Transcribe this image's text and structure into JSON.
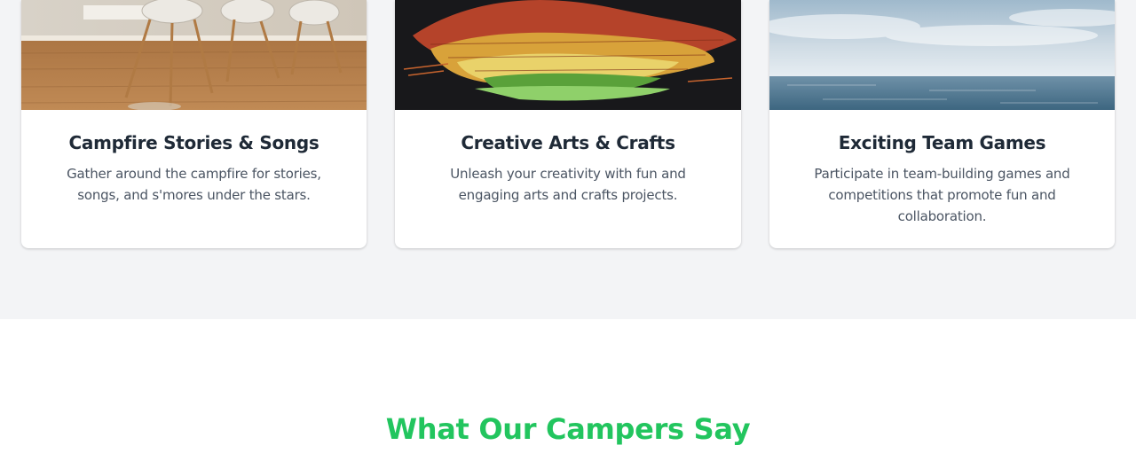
{
  "colors": {
    "section_background": "#f3f4f6",
    "card_background": "#ffffff",
    "title_color": "#1f2a37",
    "description_color": "#4b5563",
    "heading_accent": "#22c55e"
  },
  "activities": [
    {
      "title": "Campfire Stories & Songs",
      "description": "Gather around the campfire for stories, songs, and s'mores under the stars.",
      "image_icon": "dining-chairs-photo"
    },
    {
      "title": "Creative Arts & Crafts",
      "description": "Unleash your creativity with fun and engaging arts and crafts projects.",
      "image_icon": "autumn-leaves-photo"
    },
    {
      "title": "Exciting Team Games",
      "description": "Participate in team-building games and competitions that promote fun and collaboration.",
      "image_icon": "ocean-sky-photo"
    }
  ],
  "testimonials": {
    "heading": "What Our Campers Say"
  }
}
